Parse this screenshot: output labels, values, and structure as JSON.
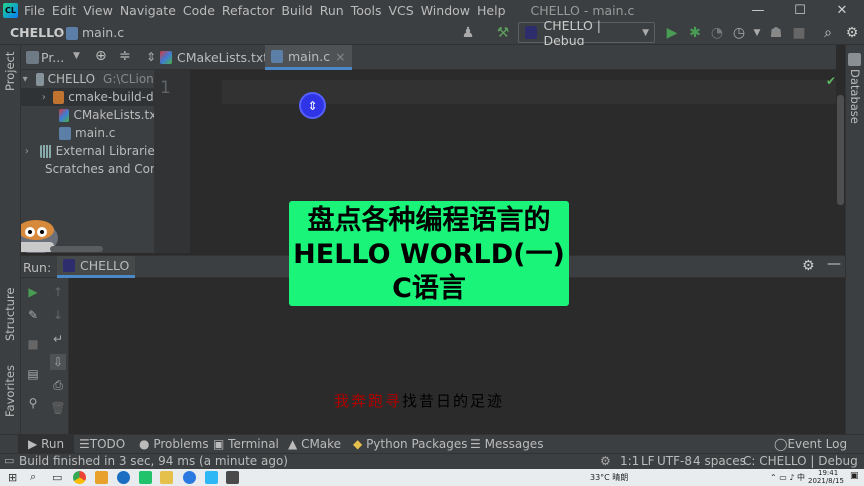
{
  "menubar": {
    "items": [
      "File",
      "Edit",
      "View",
      "Navigate",
      "Code",
      "Refactor",
      "Build",
      "Run",
      "Tools",
      "VCS",
      "Window",
      "Help"
    ],
    "window_title": "CHELLO - main.c",
    "minimize": "—",
    "maximize": "☐",
    "close": "✕"
  },
  "navbar": {
    "project": "CHELLO",
    "file": "main.c",
    "run_config": "CHELLO | Debug"
  },
  "project_panel": {
    "header": "Pr...",
    "tree": [
      {
        "label": "CHELLO",
        "path": "G:\\CLionP"
      },
      {
        "label": "cmake-build-de"
      },
      {
        "label": "CMakeLists.txt"
      },
      {
        "label": "main.c"
      },
      {
        "label": "External Libraries"
      },
      {
        "label": "Scratches and Cons"
      }
    ]
  },
  "editor": {
    "tabs": [
      {
        "label": "CMakeLists.txt",
        "close": "×"
      },
      {
        "label": "main.c",
        "close": "×"
      }
    ],
    "line_numbers": [
      "1"
    ]
  },
  "side_tabs": {
    "project": "Project",
    "structure": "Structure",
    "favorites": "Favorites",
    "database": "Database"
  },
  "run_panel": {
    "label": "Run:",
    "tab": "CHELLO"
  },
  "bottom_tabs": [
    {
      "label": "Run",
      "icon": "▶"
    },
    {
      "label": "TODO",
      "icon": "☰"
    },
    {
      "label": "Problems",
      "icon": "●"
    },
    {
      "label": "Terminal",
      "icon": "▣"
    },
    {
      "label": "CMake",
      "icon": "▲"
    },
    {
      "label": "Python Packages",
      "icon": "◆"
    },
    {
      "label": "Messages",
      "icon": "☰"
    }
  ],
  "event_log": "Event Log",
  "status": {
    "message": "Build finished in 3 sec, 94 ms (a minute ago)",
    "position": "1:1",
    "line_sep": "LF",
    "encoding": "UTF-8",
    "indent": "4 spaces",
    "context": "C: CHELLO | Debug"
  },
  "taskbar": {
    "weather": "33°C 晴朗",
    "time": "19:41",
    "date": "2021/8/15"
  },
  "overlay": {
    "line1": "盘点各种编程语言的",
    "line2": "HELLO WORLD(一)",
    "line3": "C语言"
  },
  "subtitle": {
    "red_part": "我奔跑寻",
    "black_part": "找昔日的足迹"
  },
  "colors": {
    "ide_bg": "#2b2b2b",
    "panel_bg": "#3c3f41",
    "overlay_green": "#1af57a",
    "run_green": "#499c54",
    "cursor_blue": "#2f35e6"
  }
}
